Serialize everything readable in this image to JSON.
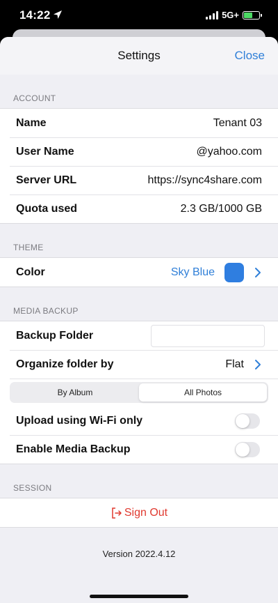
{
  "status_bar": {
    "time": "14:22",
    "network": "5G+",
    "icons": [
      "location-arrow-icon",
      "signal-icon",
      "battery-charging-icon"
    ]
  },
  "nav": {
    "title": "Settings",
    "close_label": "Close"
  },
  "account": {
    "header": "ACCOUNT",
    "rows": [
      {
        "label": "Name",
        "value": "Tenant 03"
      },
      {
        "label": "User Name",
        "value": "@yahoo.com"
      },
      {
        "label": "Server URL",
        "value": "https://sync4share.com"
      },
      {
        "label": "Quota used",
        "value": "2.3 GB/1000 GB"
      }
    ]
  },
  "theme": {
    "header": "THEME",
    "color_label": "Color",
    "color_value": "Sky Blue",
    "swatch_color": "#2f7ee0"
  },
  "media_backup": {
    "header": "MEDIA BACKUP",
    "backup_folder_label": "Backup Folder",
    "backup_folder_value": "",
    "organize_label": "Organize folder by",
    "organize_value": "Flat",
    "segments": [
      "By Album",
      "All Photos"
    ],
    "selected_segment": "All Photos",
    "wifi_only_label": "Upload using Wi-Fi only",
    "wifi_only_on": false,
    "enable_backup_label": "Enable Media Backup",
    "enable_backup_on": false
  },
  "session": {
    "header": "SESSION",
    "sign_out_label": "Sign Out"
  },
  "version": "Version 2022.4.12",
  "colors": {
    "accent": "#2f7fd8",
    "destructive": "#e0392f",
    "group_background": "#efeff4"
  }
}
